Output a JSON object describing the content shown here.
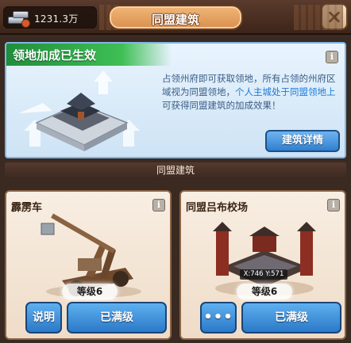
{
  "header": {
    "currency_value": "1231.3万",
    "title": "同盟建筑"
  },
  "banner": {
    "title": "领地加成已生效",
    "info_glyph": "i",
    "desc_part1": "占领州府即可获取领地，所有占领的州府区域视为同盟领地，",
    "desc_highlight": "个人主城处于同盟领地上",
    "desc_part2": "可获得同盟建筑的加成效果！",
    "detail_button": "建筑详情"
  },
  "section_title": "同盟建筑",
  "cards": [
    {
      "name": "霹雳车",
      "info_glyph": "i",
      "level": "等级6",
      "left_button": "说明",
      "main_button": "已满级"
    },
    {
      "name": "同盟吕布校场",
      "info_glyph": "i",
      "coord": "X:746 Y:571",
      "level": "等级6",
      "left_button": "•••",
      "main_button": "已满级"
    }
  ],
  "colors": {
    "banner_green": "#3fbf55",
    "button_blue": "#2b79c8",
    "highlight_blue": "#1c7bd8"
  },
  "icons": [
    "silver-ingot-icon",
    "close-icon",
    "info-icon",
    "more-icon"
  ]
}
